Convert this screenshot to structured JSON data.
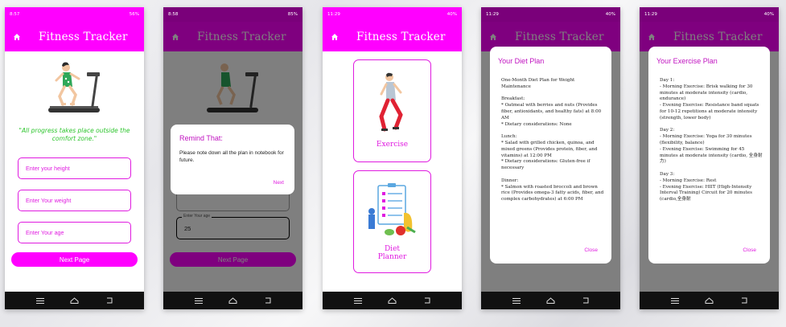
{
  "app": {
    "title": "Fitness Tracker"
  },
  "colors": {
    "appbar": "#ff00ff",
    "accent": "#e01be0",
    "quote": "#2ec52e",
    "dim_appbar": "#7a007a"
  },
  "screens": [
    {
      "status": {
        "time": "8:57",
        "right": "56%"
      },
      "quote": "\"All progress takes place outside the comfort zone.\"",
      "fields": [
        "Enter your height",
        "Enter Your weight",
        "Enter Your age"
      ],
      "button": "Next Page"
    },
    {
      "status": {
        "time": "8:58",
        "right": "85%"
      },
      "dialog": {
        "title": "Remind That:",
        "body": "Please note down all the plan in notebook for future.",
        "button": "Next"
      },
      "field_label": "Enter Your age",
      "field_value": "25",
      "button": "Next Page"
    },
    {
      "status": {
        "time": "11:29",
        "right": "40%"
      },
      "cards": [
        "Exercise",
        "Diet\nPlanner"
      ]
    },
    {
      "status": {
        "time": "11:29",
        "right": "40%"
      },
      "dialog": {
        "title": "Your Diet Plan",
        "body": "One-Month Diet Plan for Weight Maintenance\n\nBreakfast:\n* Oatmeal with berries and nuts (Provides fiber, antioxidants, and healthy fats) at 8:00 AM\n* Dietary considerations: None\n\nLunch:\n* Salad with grilled chicken, quinoa, and mixed greens (Provides protein, fiber, and vitamins) at 12:00 PM\n* Dietary considerations: Gluten-free if necessary\n\nDinner:\n* Salmon with roasted broccoli and brown rice (Provides omega-3 fatty acids, fiber, and complex carbohydrates) at 6:00 PM",
        "button": "Close"
      }
    },
    {
      "status": {
        "time": "11:29",
        "right": "40%"
      },
      "dialog": {
        "title": "Your Exercise Plan",
        "body": "Day 1:\n- Morning Exercise: Brisk walking for 30 minutes at moderate intensity (cardio, endurance)\n- Evening Exercise: Resistance band squats for 10-12 repetitions at moderate intensity (strength, lower body)\n\nDay 2:\n- Morning Exercise: Yoga for 30 minutes (flexibility, balance)\n- Evening Exercise: Swimming for 45 minutes at moderate intensity (cardio, 全身耐力)\n\nDay 3:\n- Morning Exercise: Rest\n- Evening Exercise: HIIT (High-Intensity Interval Training) Circuit for 20 minutes (cardio,全身耐",
        "button": "Close"
      }
    }
  ]
}
